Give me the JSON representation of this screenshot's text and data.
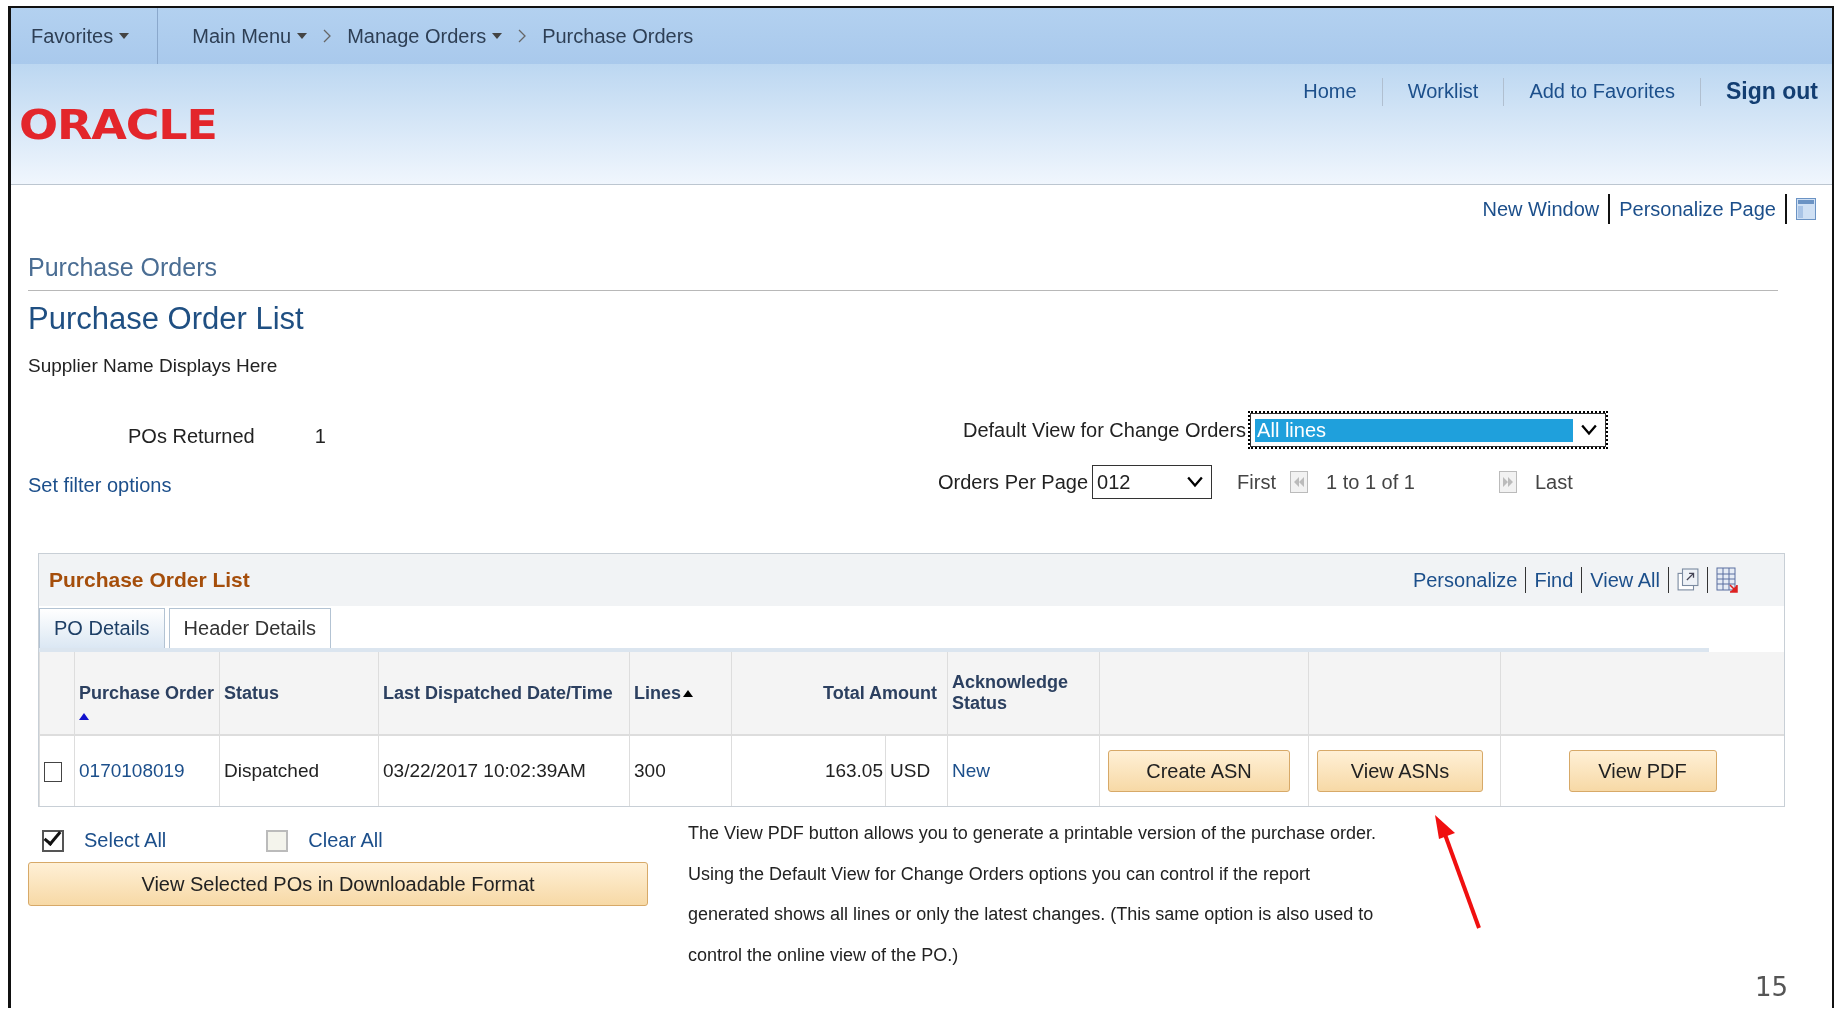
{
  "nav": {
    "menus": [
      {
        "label": "Favorites",
        "dropdown": true
      },
      {
        "label": "Main Menu",
        "dropdown": true
      }
    ],
    "breadcrumbs": [
      {
        "label": "Manage Orders",
        "dropdown": true
      },
      {
        "label": "Purchase Orders",
        "dropdown": false
      }
    ]
  },
  "header": {
    "logo": "ORACLE",
    "links": [
      {
        "label": "Home",
        "emphasized": false
      },
      {
        "label": "Worklist",
        "emphasized": false
      },
      {
        "label": "Add to Favorites",
        "emphasized": false
      },
      {
        "label": "Sign out",
        "emphasized": true
      }
    ]
  },
  "page_links": [
    "New Window",
    "Personalize Page"
  ],
  "section_title": "Purchase Orders",
  "title": "Purchase Order List",
  "supplier": "Supplier Name Displays Here",
  "pos_returned": {
    "label": "POs Returned",
    "value": "1"
  },
  "filter_link": "Set filter options",
  "default_view": {
    "label": "Default View for Change Orders",
    "value": "All lines",
    "focused": true
  },
  "orders_per_page": {
    "label": "Orders Per Page",
    "value": "012"
  },
  "pager": {
    "first": "First",
    "range": "1 to 1 of 1",
    "last": "Last"
  },
  "grid": {
    "title": "Purchase Order List",
    "tools": [
      "Personalize",
      "Find",
      "View All"
    ],
    "tabs": [
      {
        "label": "PO Details",
        "selected": true
      },
      {
        "label": "Header Details",
        "selected": false
      }
    ],
    "columns": [
      {
        "label": "Purchase Order",
        "sorted": true,
        "sort_primary": true
      },
      {
        "label": "Status",
        "sorted": false
      },
      {
        "label": "Last Dispatched Date/Time",
        "sorted": false
      },
      {
        "label": "Lines",
        "sorted": true,
        "sort_primary": false
      },
      {
        "label": "Total Amount",
        "sorted": false
      },
      {
        "label": "Acknowledge Status",
        "sorted": false
      }
    ],
    "rows": [
      {
        "selected": false,
        "po": "0170108019",
        "status": "Dispatched",
        "dispatched": "03/22/2017 10:02:39AM",
        "lines": "300",
        "amount": "163.05",
        "currency": "USD",
        "ack_status": "New",
        "actions": [
          "Create ASN",
          "View ASNs",
          "View PDF"
        ]
      }
    ]
  },
  "select_all": {
    "label": "Select All",
    "checked": true
  },
  "clear_all": {
    "label": "Clear All",
    "checked": false
  },
  "download_button": "View Selected POs in Downloadable Format",
  "note": "The View PDF button allows you to generate a printable version of the purchase order. Using the Default View for Change Orders options you can control if the report generated shows all lines or only the latest changes. (This same option is also used to control the online view of the PO.)",
  "slide_number": "15"
}
